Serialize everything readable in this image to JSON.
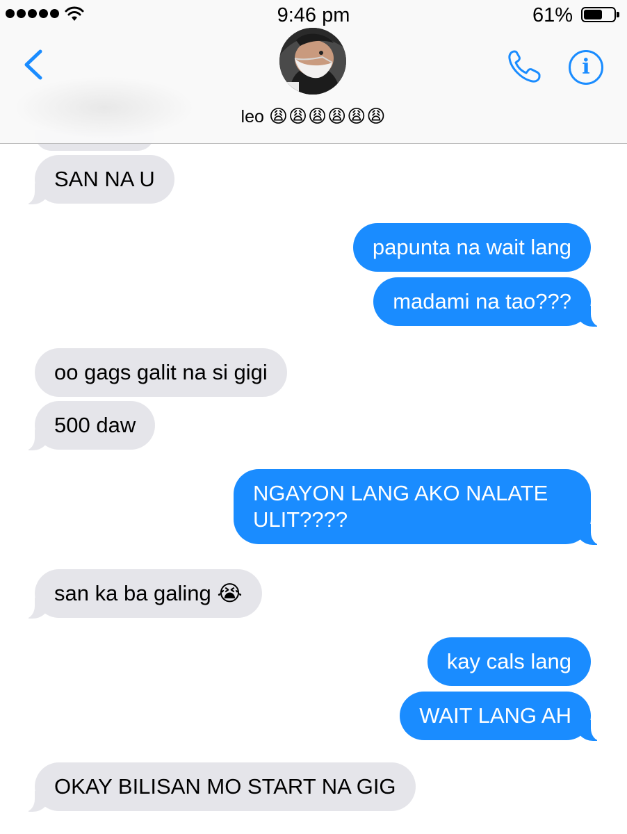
{
  "status_bar": {
    "time": "9:46 pm",
    "battery_percent": "61%",
    "battery_level": 0.61,
    "signal_bars": 5
  },
  "header": {
    "contact_name": "leo",
    "contact_emojis": "😩😩😩😩😩😩",
    "back_icon": "chevron-left-icon",
    "call_icon": "phone-icon",
    "info_icon": "info-icon",
    "info_glyph": "i",
    "accent_color": "#1a8cff"
  },
  "messages": [
    {
      "direction": "in",
      "text": "SAN NA U"
    },
    {
      "direction": "out",
      "text": "papunta na wait lang"
    },
    {
      "direction": "out",
      "text": "madami na tao???"
    },
    {
      "direction": "in",
      "text": "oo gags galit na si gigi"
    },
    {
      "direction": "in",
      "text": "500 daw"
    },
    {
      "direction": "out",
      "text": "NGAYON LANG AKO NALATE ULIT????"
    },
    {
      "direction": "in",
      "text": "san ka ba galing 😭"
    },
    {
      "direction": "out",
      "text": "kay cals lang"
    },
    {
      "direction": "out",
      "text": "WAIT LANG AH"
    },
    {
      "direction": "in",
      "text": "OKAY BILISAN MO START NA GIG"
    }
  ],
  "colors": {
    "outgoing_bubble": "#1a8cff",
    "incoming_bubble": "#e5e5ea"
  }
}
